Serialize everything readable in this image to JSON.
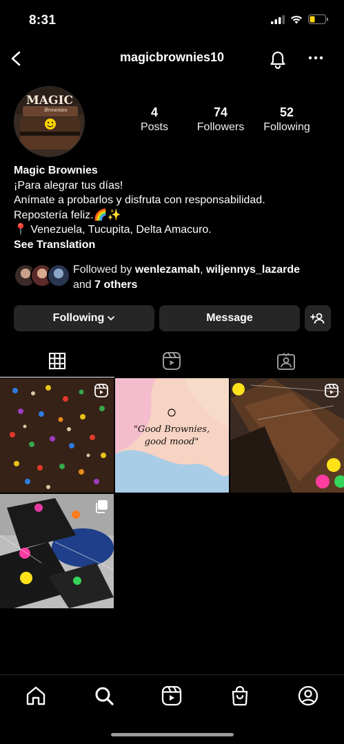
{
  "status": {
    "time": "8:31"
  },
  "header": {
    "username": "magicbrownies10"
  },
  "stats": [
    {
      "value": "4",
      "label": "Posts"
    },
    {
      "value": "74",
      "label": "Followers"
    },
    {
      "value": "52",
      "label": "Following"
    }
  ],
  "avatar": {
    "logo_text": "MAGIC",
    "logo_sub": "Brownies"
  },
  "bio": {
    "name": "Magic Brownies",
    "line1": "¡Para alegrar tus días!",
    "line2": "Anímate a probarlos y disfruta con responsabilidad.",
    "line3": "Repostería feliz.🌈✨",
    "line4": "📍 Venezuela, Tucupita, Delta Amacuro.",
    "see_translation": "See Translation"
  },
  "followed_by": {
    "prefix": "Followed by ",
    "user1": "wenlezamah",
    "sep": ", ",
    "user2": "wiljennys_lazarde",
    "and": "and ",
    "others": "7 others"
  },
  "buttons": {
    "following": "Following",
    "message": "Message"
  },
  "posts": {
    "post2_text_line1": "\"Good Brownies,",
    "post2_text_line2": "good mood\""
  },
  "colors": {
    "background": "#000000",
    "button": "#262626",
    "battery": "#ffd60a"
  }
}
